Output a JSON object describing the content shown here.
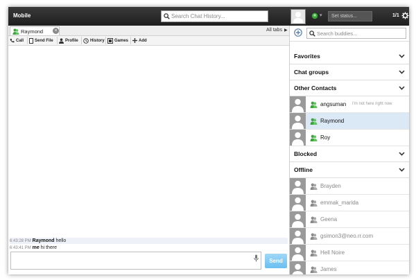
{
  "header": {
    "title": "Mobile",
    "history_search_placeholder": "Search Chat History...",
    "status_placeholder": "Set status...",
    "page_count": "1/1"
  },
  "tabs": {
    "open": [
      {
        "label": "Raymond"
      }
    ],
    "all_tabs_label": "All tabs"
  },
  "toolbar": {
    "call": "Call",
    "send_file": "Send File",
    "profile": "Profile",
    "history": "History",
    "games": "Games",
    "add": "Add"
  },
  "messages": [
    {
      "time": "6:43:28 PM",
      "sender": "Raymond",
      "text": "hello"
    },
    {
      "time": "6:43:41 PM",
      "sender": "me",
      "text": "hi there"
    }
  ],
  "composer": {
    "value": "",
    "send_label": "Send"
  },
  "buddy_pane": {
    "search_placeholder": "Search buddies...",
    "groups": {
      "favorites": "Favorites",
      "chat_groups": "Chat groups",
      "other_contacts": "Other Contacts",
      "blocked": "Blocked",
      "offline": "Offline"
    },
    "other_contacts": [
      {
        "name": "angsuman",
        "status": "I'm not here right now"
      },
      {
        "name": "Raymond",
        "status": ""
      },
      {
        "name": "Roy",
        "status": ""
      }
    ],
    "offline_contacts": [
      {
        "name": "Brayden"
      },
      {
        "name": "emmak_marida"
      },
      {
        "name": "Geena"
      },
      {
        "name": "gsimon3@neo.rr.com"
      },
      {
        "name": "Hell Noire"
      },
      {
        "name": "James"
      }
    ],
    "selected_contact": "Raymond"
  },
  "colors": {
    "topbar": "#2a2a2a",
    "online_icon": "#3aa63a",
    "offline_icon": "#8a8a8a",
    "selected_row": "#dbe8f6",
    "send_button": "#7cc8f2"
  }
}
